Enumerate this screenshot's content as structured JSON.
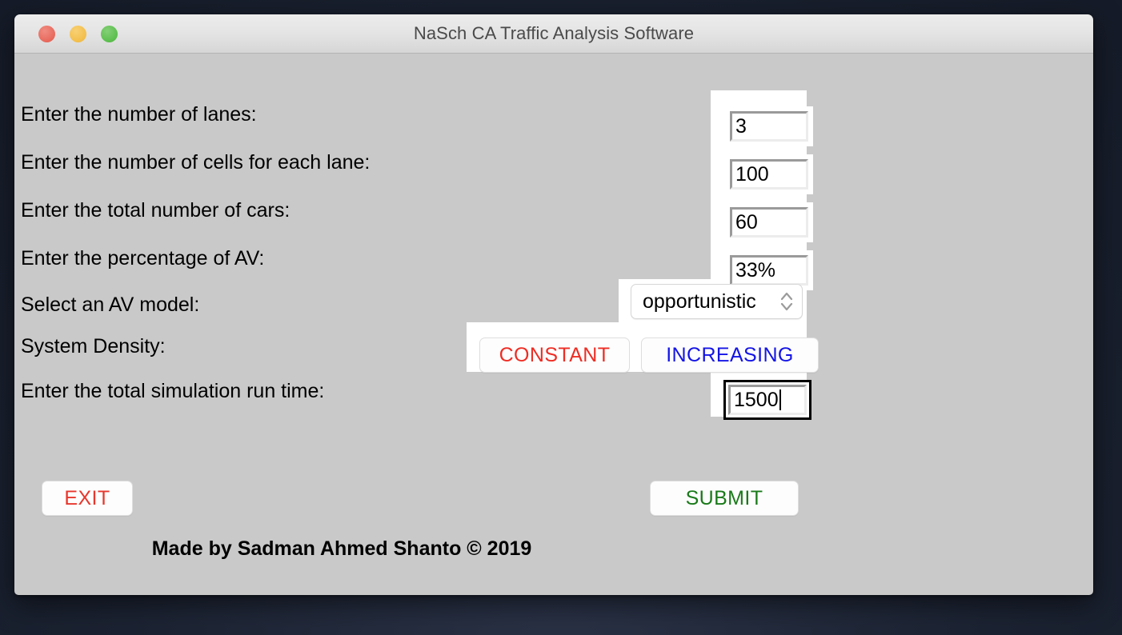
{
  "window": {
    "title": "NaSch CA Traffic Analysis Software",
    "controls": {
      "close": "close-button",
      "minimize": "minimize-button",
      "maximize": "maximize-button"
    }
  },
  "form": {
    "fields": [
      {
        "label": "Enter the number of lanes:",
        "value": "3",
        "focused": false
      },
      {
        "label": "Enter the number of cells for each lane:",
        "value": "100",
        "focused": false
      },
      {
        "label": "Enter the total number of cars:",
        "value": "60",
        "focused": false
      },
      {
        "label": "Enter the percentage of AV:",
        "value": "33%",
        "focused": false
      }
    ],
    "av_model": {
      "label": "Select an AV model:",
      "selected": "opportunistic"
    },
    "system_density": {
      "label": "System Density:",
      "constant_label": "CONSTANT",
      "increasing_label": "INCREASING"
    },
    "run_time": {
      "label": "Enter the total simulation run time:",
      "value": "1500",
      "focused": true
    }
  },
  "actions": {
    "exit_label": "EXIT",
    "submit_label": "SUBMIT"
  },
  "footer": {
    "text": "Made by Sadman Ahmed Shanto © 2019"
  },
  "colors": {
    "constant": "#ee2d24",
    "increasing": "#1414e6",
    "exit": "#e8372c",
    "submit": "#1a7a1a",
    "window_bg": "#c9c9c9",
    "titlebar": "#e4e4e4",
    "desktop": "#1d2433"
  }
}
